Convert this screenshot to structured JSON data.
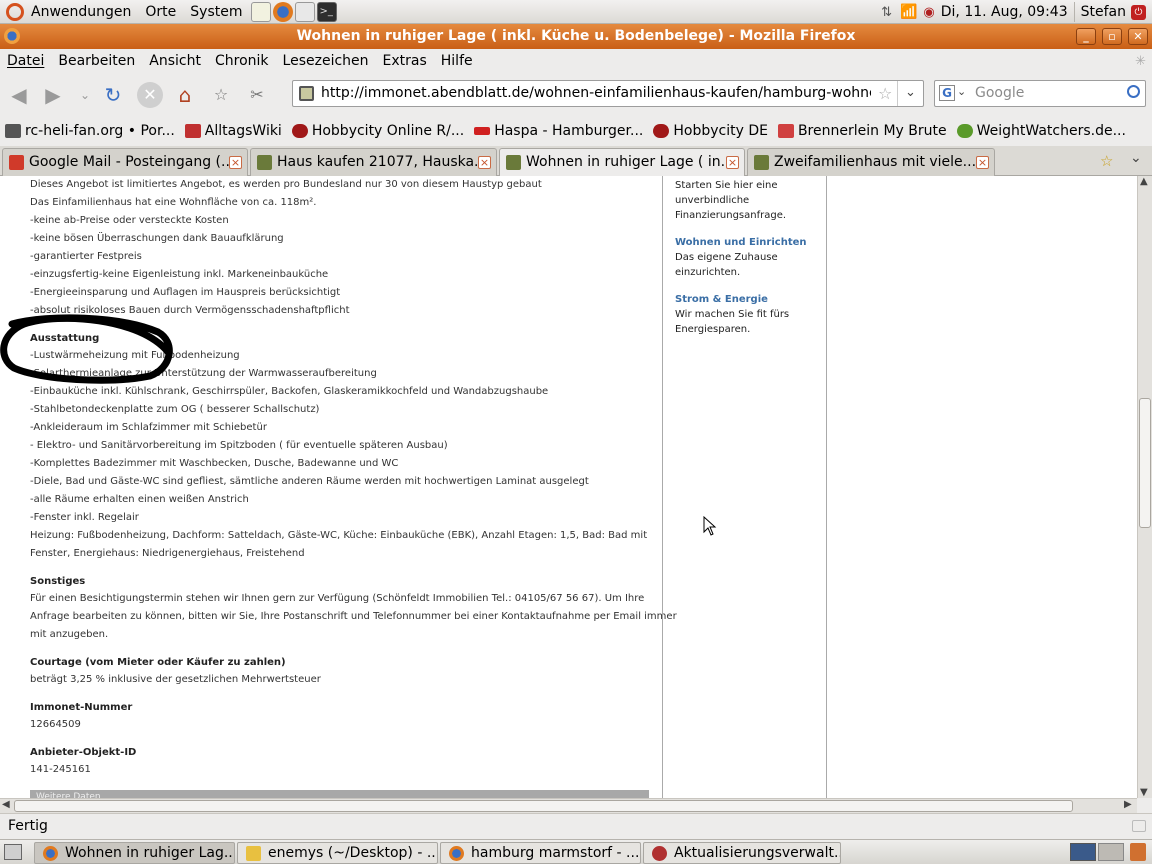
{
  "panel": {
    "menus": [
      "Anwendungen",
      "Orte",
      "System"
    ],
    "clock": "Di, 11. Aug, 09:43",
    "user": "Stefan"
  },
  "window": {
    "title": "Wohnen in ruhiger Lage ( inkl. Küche u. Bodenbelege) - Mozilla Firefox"
  },
  "menubar": {
    "items": [
      "Datei",
      "Bearbeiten",
      "Ansicht",
      "Chronik",
      "Lesezeichen",
      "Extras",
      "Hilfe"
    ]
  },
  "nav": {
    "url": "http://immonet.abendblatt.de/wohnen-einfamilienhaus-kaufen/hamburg-wohnen-in-r",
    "search_placeholder": "Google"
  },
  "bookmarks": [
    {
      "label": "rc-heli-fan.org • Por...",
      "color": "#555555"
    },
    {
      "label": "AlltagsWiki",
      "color": "#c03030"
    },
    {
      "label": "Hobbycity Online R/...",
      "color": "#a01818"
    },
    {
      "label": "Haspa - Hamburger...",
      "color": "#d02020"
    },
    {
      "label": "Hobbycity DE",
      "color": "#a01818"
    },
    {
      "label": "Brennerlein My Brute",
      "color": "#d04040"
    },
    {
      "label": "WeightWatchers.de...",
      "color": "#5a9a2a"
    }
  ],
  "tabs": [
    {
      "label": "Google Mail - Posteingang (...",
      "color": "#d03a2a"
    },
    {
      "label": "Haus kaufen 21077, Hauska...",
      "color": "#6a7a3a"
    },
    {
      "label": "Wohnen in ruhiger Lage ( in...",
      "color": "#6a7a3a"
    },
    {
      "label": "Zweifamilienhaus mit viele...",
      "color": "#6a7a3a"
    }
  ],
  "content": {
    "lines_top": [
      "Dieses Angebot ist limitiertes Angebot, es werden pro Bundesland nur 30 von diesem Haustyp gebaut",
      "Das Einfamilienhaus hat eine Wohnfläche von ca. 118m².",
      "-keine ab-Preise oder versteckte Kosten",
      "-keine bösen Überraschungen dank Bauaufklärung",
      "-garantierter Festpreis",
      "-einzugsfertig-keine Eigenleistung inkl. Markeneinbauküche",
      "-Energieeinsparung und Auflagen im Hauspreis berücksichtigt",
      "-absolut risikoloses Bauen durch Vermögensschadenshaftpflicht"
    ],
    "ausstattung_heading": "Ausstattung",
    "ausstattung_lines": [
      "-Lustwärmeheizung mit Fußbodenheizung",
      "-Solarthermieanlage zur Unterstützung der Warmwasseraufbereitung",
      "-Einbauküche inkl. Kühlschrank, Geschirrspüler, Backofen, Glaskeramikkochfeld und Wandabzugshaube",
      "-Stahlbetondeckenplatte zum OG ( besserer Schallschutz)",
      "-Ankleideraum im Schlafzimmer mit Schiebetür",
      "- Elektro- und Sanitärvorbereitung im Spitzboden ( für eventuelle späteren Ausbau)",
      "-Komplettes Badezimmer mit Waschbecken, Dusche, Badewanne und WC",
      "-Diele, Bad und Gäste-WC sind gefliest, sämtliche anderen Räume werden mit hochwertigen Laminat ausgelegt",
      "-alle Räume erhalten einen weißen Anstrich",
      "-Fenster inkl. Regelair",
      "Heizung: Fußbodenheizung, Dachform: Satteldach, Gäste-WC, Küche: Einbauküche (EBK), Anzahl Etagen: 1,5, Bad: Bad mit",
      "Fenster, Energiehaus: Niedrigenergiehaus, Freistehend"
    ],
    "sonstiges_heading": "Sonstiges",
    "sonstiges_lines": [
      "Für einen Besichtigungstermin stehen wir Ihnen gern zur Verfügung (Schönfeldt Immobilien Tel.: 04105/67 56 67). Um Ihre",
      "Anfrage bearbeiten zu können, bitten wir Sie, Ihre Postanschrift und Telefonnummer bei einer Kontaktaufnahme per Email immer",
      "mit anzugeben."
    ],
    "courtage_heading": "Courtage (vom Mieter oder Käufer zu zahlen)",
    "courtage_text": "beträgt 3,25 % inklusive der gesetzlichen Mehrwertsteuer",
    "immonet_heading": "Immonet-Nummer",
    "immonet_value": "12664509",
    "anbieter_heading": "Anbieter-Objekt-ID",
    "anbieter_value": "141-245161",
    "more_bar": "Weitere Daten"
  },
  "sidebar": {
    "finanz_lines": [
      "Starten Sie hier eine",
      "unverbindliche",
      "Finanzierungsanfrage."
    ],
    "wohnen_link": "Wohnen und Einrichten",
    "wohnen_lines": [
      "Das eigene Zuhause",
      "einzurichten."
    ],
    "strom_link": "Strom & Energie",
    "strom_lines": [
      "Wir machen Sie fit fürs",
      "Energiesparen."
    ]
  },
  "status": {
    "text": "Fertig"
  },
  "taskbar": [
    {
      "label": "Wohnen in ruhiger Lag...",
      "color": "#d06a20"
    },
    {
      "label": "enemys (~/Desktop) - ...",
      "color": "#e8c040"
    },
    {
      "label": "hamburg marmstorf - ...",
      "color": "#d06a20"
    },
    {
      "label": "Aktualisierungsverwalt...",
      "color": "#b03030"
    }
  ]
}
